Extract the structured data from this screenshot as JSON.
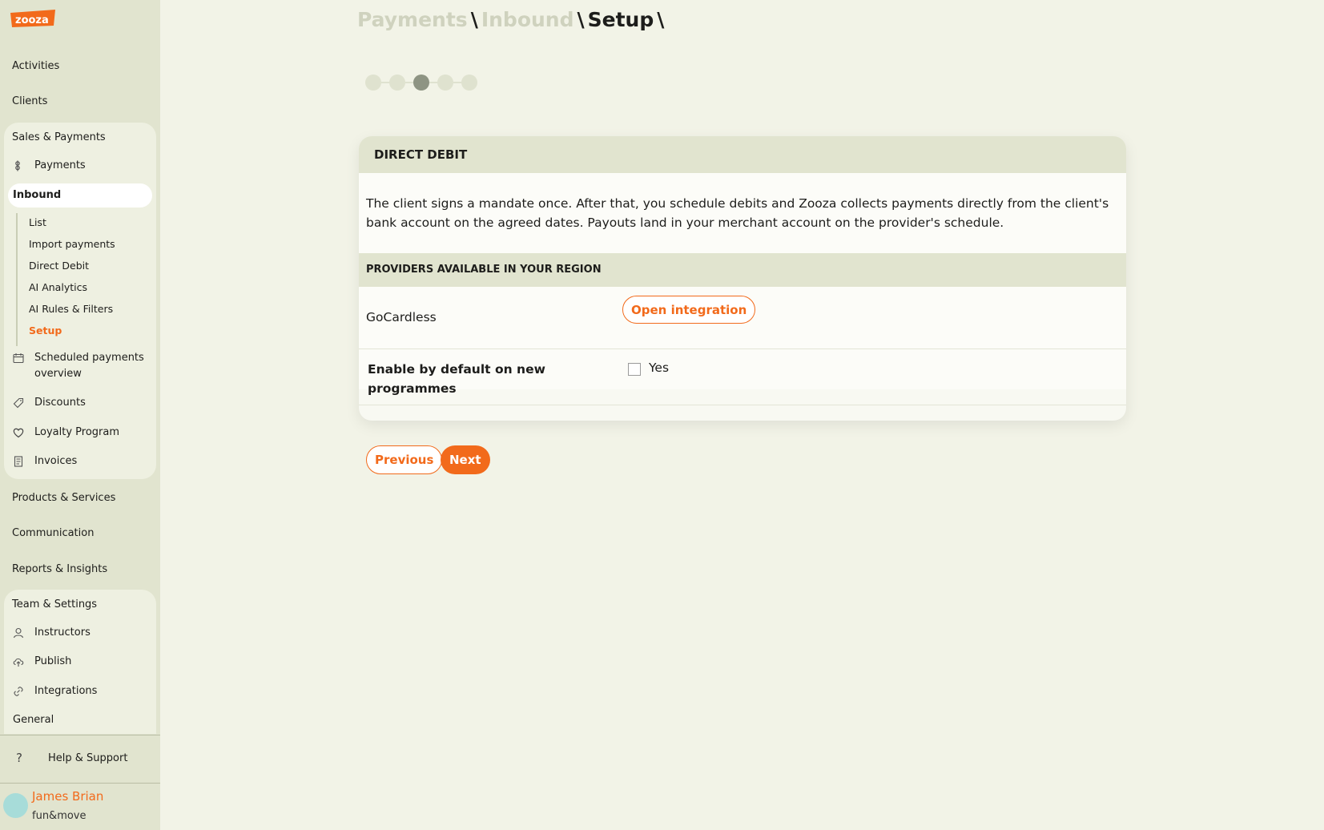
{
  "brand": {
    "logo_text": "zooza",
    "accent": "#f26a1b"
  },
  "sidebar": {
    "activities": "Activities",
    "clients": "Clients",
    "sales_group": {
      "title": "Sales & Payments",
      "payments": {
        "label": "Payments",
        "icon": "coin-icon"
      },
      "inbound": "Inbound",
      "inbound_items": [
        "List",
        "Import payments",
        "Direct Debit",
        "AI Analytics",
        "AI Rules & Filters",
        "Setup"
      ],
      "scheduled": {
        "label_line1": "Scheduled payments",
        "label_line2": "overview",
        "icon": "calendar-icon"
      },
      "discounts": {
        "label": "Discounts",
        "icon": "tag-icon"
      },
      "loyalty": {
        "label": "Loyalty Program",
        "icon": "heart-icon"
      },
      "invoices": {
        "label": "Invoices",
        "icon": "invoice-icon"
      }
    },
    "products": "Products & Services",
    "communication": "Communication",
    "reports": "Reports & Insights",
    "team_group": {
      "title": "Team & Settings",
      "instructors": {
        "label": "Instructors",
        "icon": "user-icon"
      },
      "publish": {
        "label": "Publish",
        "icon": "cloud-upload-icon"
      },
      "integrations": {
        "label": "Integrations",
        "icon": "link-icon"
      },
      "general": "General"
    },
    "help": {
      "label": "Help & Support",
      "icon_glyph": "?"
    },
    "user": {
      "name": "James Brian",
      "org": "fun&move"
    }
  },
  "breadcrumb": {
    "items": [
      "Payments",
      "Inbound",
      "Setup"
    ],
    "separator": "\\"
  },
  "stepper": {
    "total": 5,
    "active_index": 2
  },
  "card": {
    "title": "DIRECT DEBIT",
    "description": "The client signs a mandate once. After that, you schedule debits and Zooza collects payments directly from the client's bank account on the agreed dates. Payouts land in your merchant account on the provider's schedule.",
    "providers_heading": "PROVIDERS AVAILABLE IN YOUR REGION",
    "provider": {
      "name": "GoCardless",
      "action": "Open integration"
    },
    "enable_default": {
      "label_line1": "Enable by default on new",
      "label_line2": "programmes",
      "option": "Yes",
      "checked": false
    }
  },
  "actions": {
    "previous": "Previous",
    "next": "Next"
  }
}
